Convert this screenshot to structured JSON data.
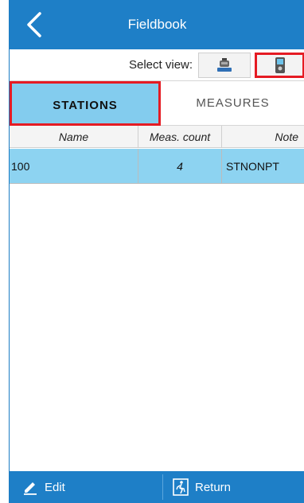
{
  "header": {
    "title": "Fieldbook",
    "back_icon": "chevron-left-icon"
  },
  "view_select": {
    "label": "Select view:",
    "options": [
      "total-station-icon",
      "controller-icon"
    ],
    "selected_index": 1
  },
  "tabs": [
    {
      "label": "STATIONS",
      "selected": true
    },
    {
      "label": "MEASURES",
      "selected": false
    }
  ],
  "table": {
    "columns": [
      "Name",
      "Meas. count",
      "Note"
    ],
    "rows": [
      {
        "name": "100",
        "meas_count": "4",
        "note": "STNONPT"
      }
    ]
  },
  "footer": {
    "edit_label": "Edit",
    "return_label": "Return"
  },
  "colors": {
    "header_blue": "#1e7fc7",
    "tab_selected": "#83ccee",
    "row_selected": "#8dd3f1",
    "highlight_red": "#e51b23"
  }
}
